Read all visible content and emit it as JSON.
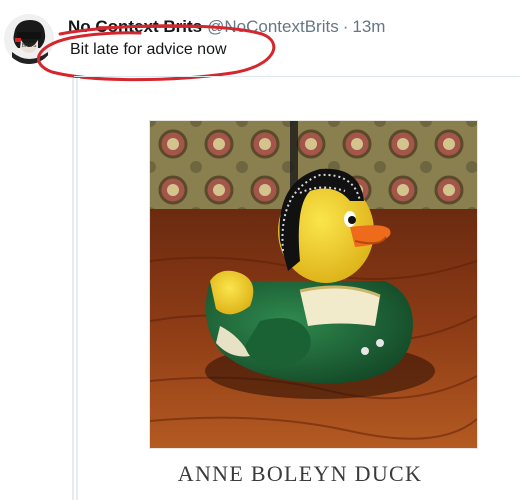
{
  "tweet": {
    "display_name": "No Context Brits",
    "handle": "@NoContextBrits",
    "separator": "·",
    "time": "13m",
    "text": "Bit late for advice now"
  },
  "image": {
    "caption": "ANNE BOLEYN DUCK"
  },
  "icons": {
    "avatar": "avatar-icon"
  },
  "colors": {
    "annotation_circle": "#d4272d",
    "duck_yellow": "#f0cf2a",
    "duck_green": "#1f6b3b",
    "beak_orange": "#ee6b1b"
  }
}
